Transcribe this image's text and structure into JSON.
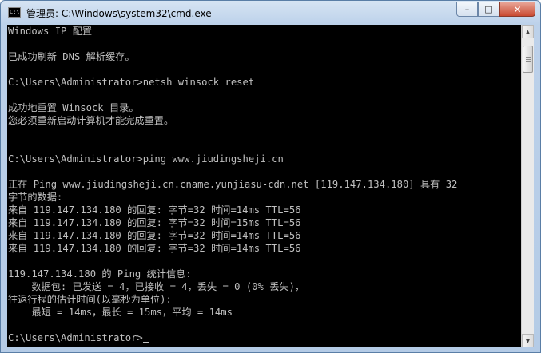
{
  "window": {
    "title": "管理员: C:\\Windows\\system32\\cmd.exe",
    "icon_label": "C:\\",
    "controls": {
      "minimize": "–",
      "maximize": "□",
      "close": "✕"
    }
  },
  "console": {
    "lines": [
      "Windows IP 配置",
      "",
      "已成功刷新 DNS 解析缓存。",
      "",
      "C:\\Users\\Administrator>netsh winsock reset",
      "",
      "成功地重置 Winsock 目录。",
      "您必须重新启动计算机才能完成重置。",
      "",
      "",
      "C:\\Users\\Administrator>ping www.jiudingsheji.cn",
      "",
      "正在 Ping www.jiudingsheji.cn.cname.yunjiasu-cdn.net [119.147.134.180] 具有 32",
      "字节的数据:",
      "来自 119.147.134.180 的回复: 字节=32 时间=14ms TTL=56",
      "来自 119.147.134.180 的回复: 字节=32 时间=15ms TTL=56",
      "来自 119.147.134.180 的回复: 字节=32 时间=14ms TTL=56",
      "来自 119.147.134.180 的回复: 字节=32 时间=14ms TTL=56",
      "",
      "119.147.134.180 的 Ping 统计信息:",
      "    数据包: 已发送 = 4，已接收 = 4，丢失 = 0 (0% 丢失)，",
      "往返行程的估计时间(以毫秒为单位):",
      "    最短 = 14ms，最长 = 15ms，平均 = 14ms",
      "",
      "C:\\Users\\Administrator>"
    ]
  },
  "scrollbar": {
    "up_arrow": "▲",
    "down_arrow": "▼"
  }
}
